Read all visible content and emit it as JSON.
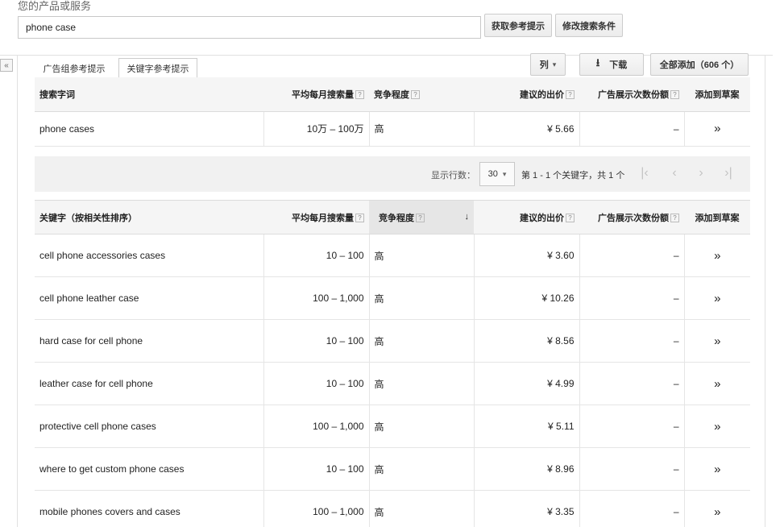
{
  "header": {
    "label": "您的产品或服务",
    "search_value": "phone case",
    "get_ideas_button": "获取参考提示",
    "modify_search_button": "修改搜索条件"
  },
  "sidebar": {
    "collapse_icon": "«"
  },
  "tabs": [
    {
      "label": "广告组参考提示",
      "active": false
    },
    {
      "label": "关键字参考提示",
      "active": true
    }
  ],
  "toolbar": {
    "columns_label": "列",
    "download_label": "下载",
    "add_all_label": "全部添加（606 个）"
  },
  "search_terms_table": {
    "headers": [
      "搜索字词",
      "平均每月搜索量",
      "竞争程度",
      "建议的出价",
      "广告展示次数份额",
      "添加到草案"
    ],
    "rows": [
      {
        "keyword": "phone cases",
        "volume": "10万 – 100万",
        "competition": "高",
        "bid": "¥ 5.66",
        "share": "–"
      }
    ]
  },
  "pager": {
    "rows_label": "显示行数：",
    "rows_value": "30",
    "summary": "第 1 - 1 个关键字，共 1 个"
  },
  "keyword_table": {
    "headers": [
      "关键字（按相关性排序）",
      "平均每月搜索量",
      "竞争程度",
      "建议的出价",
      "广告展示次数份额",
      "添加到草案"
    ],
    "rows": [
      {
        "keyword": "cell phone accessories cases",
        "volume": "10 – 100",
        "competition": "高",
        "bid": "¥ 3.60",
        "share": "–"
      },
      {
        "keyword": "cell phone leather case",
        "volume": "100 – 1,000",
        "competition": "高",
        "bid": "¥ 10.26",
        "share": "–"
      },
      {
        "keyword": "hard case for cell phone",
        "volume": "10 – 100",
        "competition": "高",
        "bid": "¥ 8.56",
        "share": "–"
      },
      {
        "keyword": "leather case for cell phone",
        "volume": "10 – 100",
        "competition": "高",
        "bid": "¥ 4.99",
        "share": "–"
      },
      {
        "keyword": "protective cell phone cases",
        "volume": "100 – 1,000",
        "competition": "高",
        "bid": "¥ 5.11",
        "share": "–"
      },
      {
        "keyword": "where to get custom phone cases",
        "volume": "10 – 100",
        "competition": "高",
        "bid": "¥ 8.96",
        "share": "–"
      },
      {
        "keyword": "mobile phones covers and cases",
        "volume": "100 – 1,000",
        "competition": "高",
        "bid": "¥ 3.35",
        "share": "–"
      }
    ]
  },
  "icons": {
    "help": "?",
    "add_arrow": "»",
    "sort_down": "↓",
    "dropdown": "▾",
    "download": "⭳",
    "first_page": "|‹",
    "prev_page": "‹",
    "next_page": "›",
    "last_page": "›|"
  }
}
